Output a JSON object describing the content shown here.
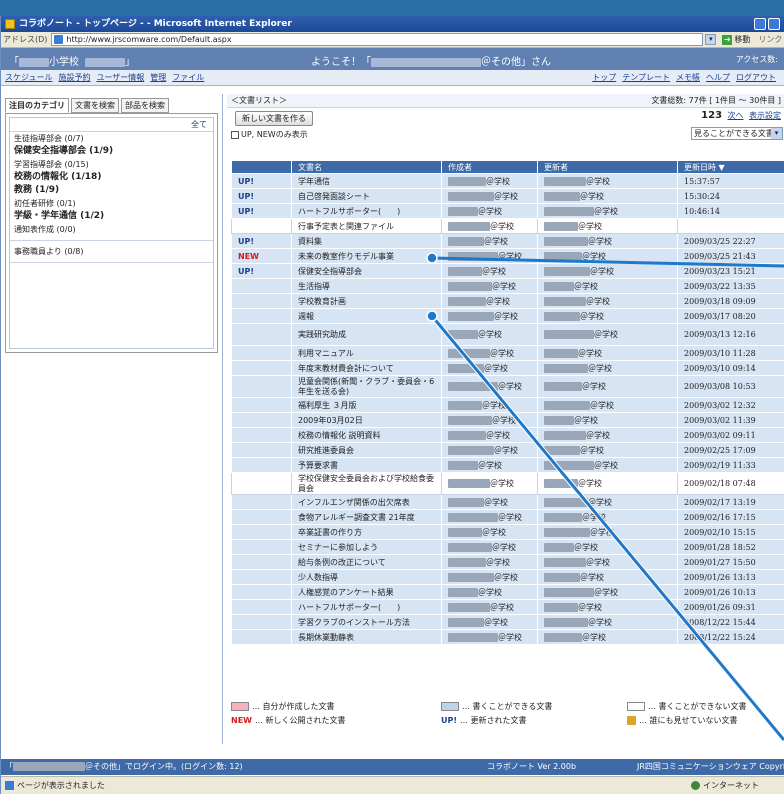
{
  "browser": {
    "title": "コラボノート - トップページ - - Microsoft Internet Explorer",
    "address_label": "アドレス(D)",
    "url": "http://www.jrscomware.com/Default.aspx",
    "go_label": "移動",
    "links_label": "リンク"
  },
  "header": {
    "school_prefix": "「",
    "school_suffix": "小学校",
    "school_close": "」",
    "welcome_prefix": "ようこそ！「",
    "welcome_suffix": "＠その他」さん",
    "access_label": "アクセス数:"
  },
  "nav": {
    "left": [
      "スケジュール",
      "施設予約",
      "ユーザー情報",
      "管理",
      "ファイル"
    ],
    "right": [
      "トップ",
      "テンプレート",
      "メモ帳",
      "ヘルプ",
      "ログアウト"
    ]
  },
  "sidebar": {
    "tabs": [
      "注目のカテゴリ",
      "文書を検索",
      "部品を検索"
    ],
    "all_label": "全て",
    "categories": [
      {
        "label": "生徒指導部会 (0/7)",
        "bold": false
      },
      {
        "label": "保健安全指導部会 (1/9)",
        "bold": true
      },
      {
        "label": "学習指導部会 (0/15)",
        "bold": false
      },
      {
        "label": "校務の情報化 (1/18)",
        "bold": true
      },
      {
        "label": "教務 (1/9)",
        "bold": true
      },
      {
        "label": "初任者研修 (0/1)",
        "bold": false
      },
      {
        "label": "学級・学年通信 (1/2)",
        "bold": true
      },
      {
        "label": "通知表作成 (0/0)",
        "bold": false
      }
    ],
    "extra_category": "事務職員より (0/8)"
  },
  "main": {
    "breadcrumb": "＜文書リスト＞",
    "total": "文書総数: 77件 [ 1件目 ～ 30件目 ]",
    "new_button": "新しい文書を作る",
    "pager_pages": "123",
    "pager_next": "次へ",
    "pager_settings": "表示設定",
    "filter_label": "UP, NEWのみ表示",
    "view_select": "見ることができる文書",
    "columns": {
      "name": "文書名",
      "creator": "作成者",
      "updater": "更新者",
      "date": "更新日時 ▼"
    },
    "school_label": "＠学校",
    "rows": [
      {
        "badge": "UP!",
        "name": "学年通信",
        "date": "15:37:57",
        "white": false,
        "tall": false
      },
      {
        "badge": "UP!",
        "name": "自己啓発面談シート",
        "date": "15:30:24",
        "white": false,
        "tall": false
      },
      {
        "badge": "UP!",
        "name": "ハートフルサポーター(　　)",
        "date": "10:46:14",
        "white": false,
        "tall": false
      },
      {
        "badge": "",
        "name": "行事予定表と関連ファイル",
        "date": "",
        "white": true,
        "tall": false
      },
      {
        "badge": "UP!",
        "name": "資料集",
        "date": "2009/03/25 22:27",
        "white": false,
        "tall": false
      },
      {
        "badge": "NEW",
        "name": "未来の教室作りモデル事業",
        "date": "2009/03/25 21:43",
        "white": false,
        "tall": false
      },
      {
        "badge": "UP!",
        "name": "保健安全指導部会",
        "date": "2009/03/23 15:21",
        "white": false,
        "tall": false
      },
      {
        "badge": "",
        "name": "生活指導",
        "date": "2009/03/22 13:35",
        "white": false,
        "tall": false
      },
      {
        "badge": "",
        "name": "学校教育計画",
        "date": "2009/03/18 09:09",
        "white": false,
        "tall": false
      },
      {
        "badge": "",
        "name": "週報",
        "date": "2009/03/17 08:20",
        "white": false,
        "tall": false
      },
      {
        "badge": "",
        "name": "実践研究助成",
        "date": "2009/03/13 12:16",
        "white": false,
        "tall": true
      },
      {
        "badge": "",
        "name": "利用マニュアル",
        "date": "2009/03/10 11:28",
        "white": false,
        "tall": false
      },
      {
        "badge": "",
        "name": "年度末教材費会計について",
        "date": "2009/03/10 09:14",
        "white": false,
        "tall": false
      },
      {
        "badge": "",
        "name": "児童会関係(新聞・クラブ・委員会・6年生を送る会)",
        "date": "2009/03/08 10:53",
        "white": false,
        "tall": true
      },
      {
        "badge": "",
        "name": "福利厚生 ３月版",
        "date": "2009/03/02 12:32",
        "white": false,
        "tall": false
      },
      {
        "badge": "",
        "name": "2009年03月02日",
        "date": "2009/03/02 11:39",
        "white": false,
        "tall": false
      },
      {
        "badge": "",
        "name": "校務の情報化 説明資料",
        "date": "2009/03/02 09:11",
        "white": false,
        "tall": false
      },
      {
        "badge": "",
        "name": "研究推進委員会",
        "date": "2009/02/25 17:09",
        "white": false,
        "tall": false
      },
      {
        "badge": "",
        "name": "予算要求書",
        "date": "2009/02/19 11:33",
        "white": false,
        "tall": false
      },
      {
        "badge": "",
        "name": "学校保健安全委員会および学校給食委員会",
        "date": "2009/02/18 07:48",
        "white": true,
        "tall": true
      },
      {
        "badge": "",
        "name": "インフルエンザ関係の出欠席表",
        "date": "2009/02/17 13:19",
        "white": false,
        "tall": false
      },
      {
        "badge": "",
        "name": "食物アレルギー調査文書 21年度",
        "date": "2009/02/16 17:15",
        "white": false,
        "tall": false
      },
      {
        "badge": "",
        "name": "卒業証書の作り方",
        "date": "2009/02/10 15:15",
        "white": false,
        "tall": false
      },
      {
        "badge": "",
        "name": "セミナーに参加しよう",
        "date": "2009/01/28 18:52",
        "white": false,
        "tall": false
      },
      {
        "badge": "",
        "name": "給与条例の改正について",
        "date": "2009/01/27 15:50",
        "white": false,
        "tall": false
      },
      {
        "badge": "",
        "name": "少人数指導",
        "date": "2009/01/26 13:13",
        "white": false,
        "tall": false
      },
      {
        "badge": "",
        "name": "人権感覚のアンケート結果",
        "date": "2009/01/26 10:13",
        "white": false,
        "tall": false
      },
      {
        "badge": "",
        "name": "ハートフルサポーター(　　)",
        "date": "2009/01/26 09:31",
        "white": false,
        "tall": false
      },
      {
        "badge": "",
        "name": "学習クラブのインストール方法",
        "date": "2008/12/22 15:44",
        "white": false,
        "tall": false
      },
      {
        "badge": "",
        "name": "長期休業動静表",
        "date": "2008/12/22 15:24",
        "white": false,
        "tall": false
      }
    ],
    "legend": {
      "own": "… 自分が作成した文書",
      "writable": "… 書くことができる文書",
      "readonly": "… 書くことができない文書",
      "new_word": "NEW",
      "new_text": "… 新しく公開された文書",
      "up_word": "UP!",
      "up_text": "… 更新された文書",
      "hidden_text": "… 誰にも見せていない文書"
    }
  },
  "footer": {
    "login_prefix": "「",
    "login_text": "＠その他」でログイン中。(ログイン数: 12)",
    "version": "コラボノート Ver 2.00b",
    "copyright": "JR四国コミュニケーションウェア Copyright (C) 2006-"
  },
  "status": {
    "done": "ページが表示されました",
    "zone": "インターネット"
  },
  "colors": {
    "accent": "#3f6aa8",
    "row": "#d6e4f3",
    "overlay_line": "#1f78c8",
    "new": "#d11c1c"
  }
}
